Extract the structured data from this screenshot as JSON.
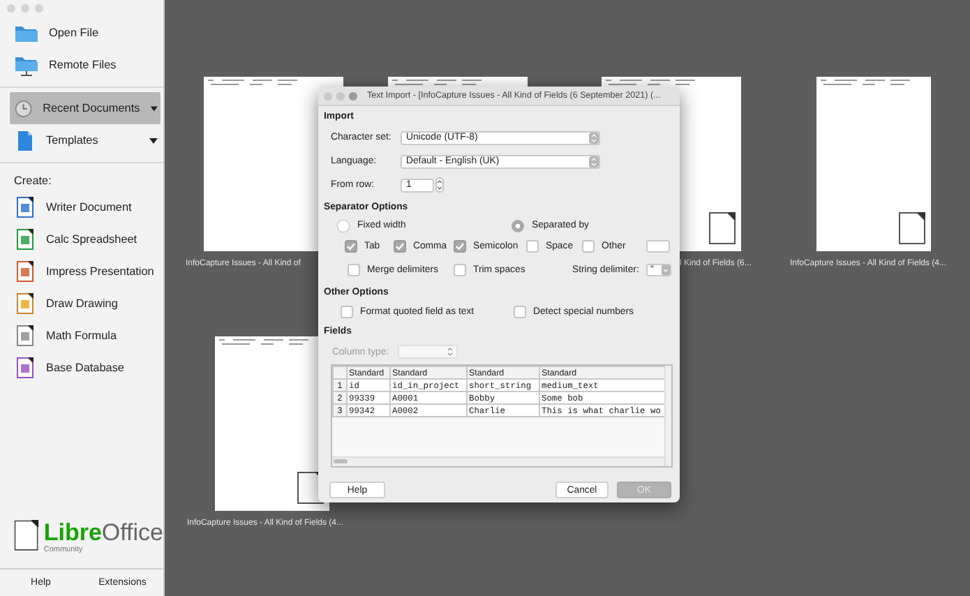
{
  "sidebar": {
    "actions": [
      {
        "label": "Open File",
        "kind": "folder"
      },
      {
        "label": "Remote Files",
        "kind": "remote"
      }
    ],
    "nav": [
      {
        "label": "Recent Documents",
        "kind": "recent",
        "selected": true
      },
      {
        "label": "Templates",
        "kind": "templates",
        "selected": false
      }
    ],
    "create_heading": "Create:",
    "create_items": [
      {
        "label": "Writer Document",
        "kind": "writer"
      },
      {
        "label": "Calc Spreadsheet",
        "kind": "calc"
      },
      {
        "label": "Impress Presentation",
        "kind": "impress"
      },
      {
        "label": "Draw Drawing",
        "kind": "draw"
      },
      {
        "label": "Math Formula",
        "kind": "math"
      },
      {
        "label": "Base Database",
        "kind": "base"
      }
    ],
    "logo": {
      "brand_first": "Libre",
      "brand_second": "Office",
      "edition": "Community"
    },
    "footer_buttons": [
      "Help",
      "Extensions"
    ]
  },
  "recent_documents": [
    {
      "kind": "document",
      "caption": "InfoCapture Issues - All Kind of"
    },
    {
      "kind": "document"
    },
    {
      "kind": "document",
      "caption": "l Kind of Fields (6..."
    },
    {
      "kind": "document",
      "caption": "InfoCapture Issues - All Kind of Fields (4..."
    },
    {
      "kind": "document",
      "caption": "InfoCapture Issues - All Kind of Fields (4..."
    }
  ],
  "dialog": {
    "title": "Text Import - [InfoCapture Issues - All Kind of Fields (6 September 2021) (...",
    "import": {
      "heading": "Import",
      "character_set": {
        "label": "Character set:",
        "value": "Unicode (UTF-8)"
      },
      "language": {
        "label": "Language:",
        "value": "Default - English (UK)"
      },
      "from_row": {
        "label": "From row:",
        "value": "1"
      }
    },
    "separator_options": {
      "heading": "Separator Options",
      "modes": [
        {
          "label": "Fixed width",
          "selected": false
        },
        {
          "label": "Separated by",
          "selected": true
        }
      ],
      "separators": [
        {
          "label": "Tab",
          "checked": true
        },
        {
          "label": "Comma",
          "checked": true
        },
        {
          "label": "Semicolon",
          "checked": true
        },
        {
          "label": "Space",
          "checked": false
        },
        {
          "label": "Other",
          "checked": false
        }
      ],
      "options": [
        {
          "label": "Merge delimiters",
          "checked": false
        },
        {
          "label": "Trim spaces",
          "checked": false
        }
      ],
      "string_delimiter": {
        "label": "String delimiter:",
        "value": "\""
      }
    },
    "other_options": {
      "heading": "Other Options",
      "options": [
        {
          "label": "Format quoted field as text",
          "checked": false
        },
        {
          "label": "Detect special numbers",
          "checked": false
        }
      ]
    },
    "fields": {
      "heading": "Fields",
      "column_type": {
        "label": "Column type:",
        "disabled": true
      },
      "table": {
        "columns": [
          "Standard",
          "Standard",
          "Standard",
          "Standard"
        ],
        "rows": [
          {
            "number": "1",
            "cells": [
              "id",
              "id_in_project",
              "short_string",
              "medium_text"
            ]
          },
          {
            "number": "2",
            "cells": [
              "99339",
              "A0001",
              "Bobby",
              "Some bob"
            ]
          },
          {
            "number": "3",
            "cells": [
              "99342",
              "A0002",
              "Charlie",
              "This is what charlie wo"
            ]
          }
        ]
      }
    },
    "buttons": [
      {
        "label": "Help",
        "kind": "help",
        "disabled": false
      },
      {
        "label": "Cancel",
        "kind": "cancel",
        "disabled": false
      },
      {
        "label": "OK",
        "kind": "ok",
        "disabled": true
      }
    ]
  }
}
